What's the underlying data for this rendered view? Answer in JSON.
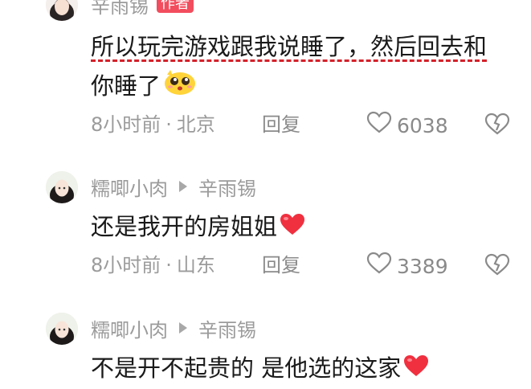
{
  "comments": [
    {
      "author": "辛雨锡",
      "badge": "作者",
      "text_lines": [
        "所以玩完游戏跟我说睡了，然后回去和",
        "你睡了"
      ],
      "time": "8小时前",
      "location": "北京",
      "reply_label": "回复",
      "likes": "6038"
    },
    {
      "author": "糯唧小肉",
      "reply_to": "辛雨锡",
      "text": "还是我开的房姐姐",
      "time": "8小时前",
      "location": "山东",
      "reply_label": "回复",
      "likes": "3389"
    },
    {
      "author": "糯唧小肉",
      "reply_to": "辛雨锡",
      "text": "不是开不起贵的 是他选的这家"
    }
  ],
  "separator": "·",
  "icons": {
    "like": "heart-outline-icon",
    "dislike": "broken-heart-icon",
    "emoji_heart": "red-heart-emoji",
    "emoji_face": "pleading-face-emoji",
    "reply_arrow": "reply-arrow-icon"
  },
  "colors": {
    "badge": "#f24d5e",
    "underline": "#d4212a",
    "muted_text": "#9b9b9b",
    "heart": "#f0303f"
  }
}
